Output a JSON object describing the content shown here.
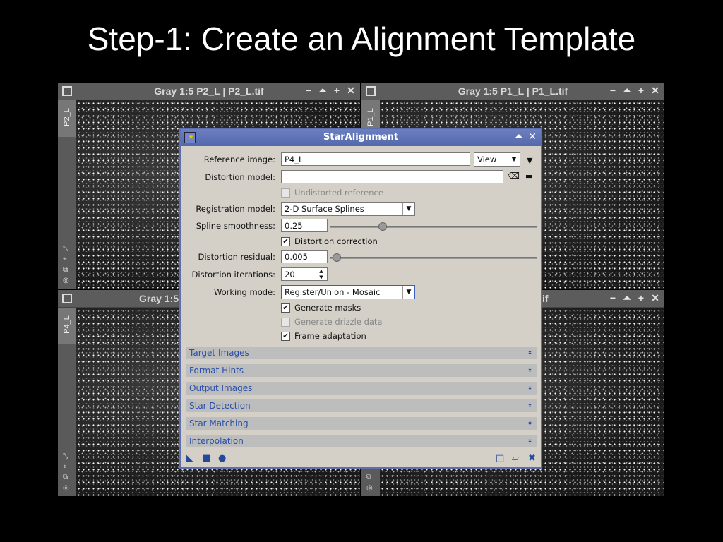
{
  "slide": {
    "title": "Step-1: Create an Alignment Template"
  },
  "windows": [
    {
      "title": "Gray 1:5 P2_L | P2_L.tif",
      "tab": "P2_L"
    },
    {
      "title": "Gray 1:5 P1_L | P1_L.tif",
      "tab": "P1_L"
    },
    {
      "title": "Gray 1:5 P",
      "tab": "P4_L"
    },
    {
      "title": "if",
      "tab": ""
    }
  ],
  "window_buttons": {
    "minimize": "−",
    "shade": "⏶",
    "maximize": "+",
    "close": "✕"
  },
  "dialog": {
    "title": "StarAlignment",
    "reference_image": {
      "label": "Reference image:",
      "value": "P4_L",
      "view_option": "View"
    },
    "distortion_model": {
      "label": "Distortion model:",
      "value": ""
    },
    "undistorted_reference": {
      "label": "Undistorted reference",
      "checked": false,
      "enabled": false
    },
    "registration_model": {
      "label": "Registration model:",
      "value": "2-D Surface Splines"
    },
    "spline_smoothness": {
      "label": "Spline smoothness:",
      "value": "0.25",
      "slider_fraction": 0.25
    },
    "distortion_correction": {
      "label": "Distortion correction",
      "checked": true
    },
    "distortion_residual": {
      "label": "Distortion residual:",
      "value": "0.005",
      "slider_fraction": 0.005
    },
    "distortion_iterations": {
      "label": "Distortion iterations:",
      "value": "20"
    },
    "working_mode": {
      "label": "Working mode:",
      "value": "Register/Union - Mosaic"
    },
    "generate_masks": {
      "label": "Generate masks",
      "checked": true
    },
    "generate_drizzle": {
      "label": "Generate drizzle data",
      "checked": false,
      "enabled": false
    },
    "frame_adaptation": {
      "label": "Frame adaptation",
      "checked": true
    },
    "sections": [
      "Target Images",
      "Format Hints",
      "Output Images",
      "Star Detection",
      "Star Matching",
      "Interpolation"
    ],
    "check_mark": "✔",
    "chevron": "⯯"
  },
  "icons": {
    "new_instance": "triangle-icon",
    "apply_global": "square-icon",
    "apply": "circle-icon",
    "preview": "preview-icon",
    "edit_instance": "document-icon",
    "reset": "reset-icon"
  },
  "colors": {
    "dialog_title": "#5468ad",
    "section_text": "#2a50a8",
    "status_green": "#33cc88"
  }
}
